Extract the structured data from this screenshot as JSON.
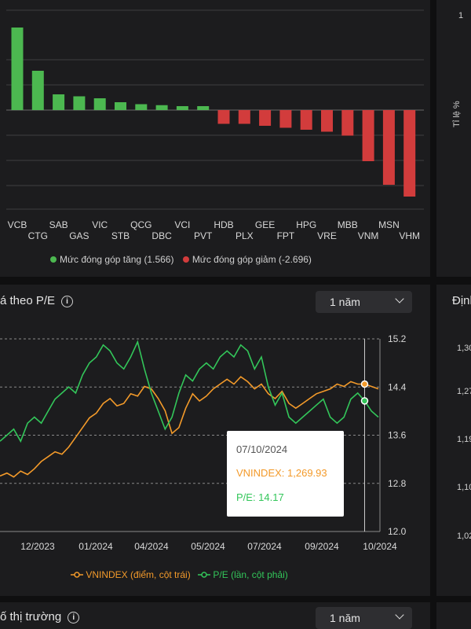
{
  "top_panel": {
    "legend_up": "Mức đóng góp tăng (1.566)",
    "legend_down": "Mức đóng góp giảm (-2.696)",
    "right_label": "Tỉ lệ %",
    "right_tick": "1",
    "colors": {
      "up": "#4cb850",
      "down": "#d23c3c"
    }
  },
  "middle_panel": {
    "title": "á theo P/E",
    "period": "1 năm",
    "legend_vnindex": "VNINDEX (điểm, cột trái)",
    "legend_pe": "P/E (lần, cột phải)",
    "colors": {
      "vnindex": "#f39a2a",
      "pe": "#33c65a"
    },
    "tooltip": {
      "date": "07/10/2024",
      "vnindex": "VNINDEX: 1,269.93",
      "pe": "P/E: 14.17"
    }
  },
  "bottom_panel": {
    "title": "ố thị trường",
    "period": "1 năm"
  },
  "right_partial": {
    "title": "Định",
    "ticks": [
      "1,30",
      "1,27",
      "1,19",
      "1,10",
      "1,02"
    ]
  },
  "chart_data": [
    {
      "type": "bar",
      "categories": [
        "VCB",
        "CTG",
        "SAB",
        "GAS",
        "VIC",
        "STB",
        "QCG",
        "DBC",
        "VCI",
        "PVT",
        "HDB",
        "PLX",
        "GEE",
        "FPT",
        "HPG",
        "VRE",
        "MBB",
        "VNM",
        "MSN",
        "VHM"
      ],
      "values": [
        0.42,
        0.2,
        0.08,
        0.07,
        0.06,
        0.04,
        0.03,
        0.025,
        0.02,
        0.02,
        -0.07,
        -0.07,
        -0.08,
        -0.09,
        -0.1,
        -0.11,
        -0.13,
        -0.26,
        -0.38,
        -0.44
      ],
      "series": [
        {
          "name": "Mức đóng góp tăng (1.566)"
        },
        {
          "name": "Mức đóng góp giảm (-2.696)"
        }
      ]
    },
    {
      "type": "line",
      "x_ticks": [
        "12/2023",
        "01/2024",
        "04/2024",
        "05/2024",
        "07/2024",
        "09/2024",
        "10/2024"
      ],
      "y2_ticks": [
        "15.2",
        "14.4",
        "13.6",
        "12.8",
        "12.0"
      ],
      "y2lim": [
        12.0,
        15.2
      ],
      "series": [
        {
          "name": "VNINDEX (điểm, cột trái)",
          "values": [
            1080,
            1086,
            1078,
            1090,
            1083,
            1095,
            1110,
            1120,
            1130,
            1125,
            1140,
            1160,
            1180,
            1200,
            1210,
            1230,
            1240,
            1225,
            1230,
            1250,
            1245,
            1265,
            1260,
            1240,
            1215,
            1168,
            1180,
            1220,
            1250,
            1235,
            1245,
            1260,
            1270,
            1280,
            1270,
            1285,
            1275,
            1260,
            1270,
            1250,
            1240,
            1255,
            1230,
            1220,
            1230,
            1240,
            1250,
            1255,
            1260,
            1270,
            1265,
            1275,
            1270,
            1269.93,
            1265,
            1260
          ]
        },
        {
          "name": "P/E (lần, cột phải)",
          "values": [
            13.5,
            13.6,
            13.7,
            13.5,
            13.8,
            13.9,
            13.8,
            14.0,
            14.2,
            14.3,
            14.4,
            14.3,
            14.6,
            14.8,
            14.9,
            15.1,
            15.0,
            14.8,
            14.7,
            14.9,
            15.15,
            14.7,
            14.3,
            14.0,
            13.7,
            13.9,
            14.3,
            14.6,
            14.5,
            14.7,
            14.8,
            14.7,
            14.9,
            15.0,
            14.9,
            15.1,
            15.0,
            14.7,
            14.9,
            14.4,
            14.1,
            14.3,
            13.9,
            13.8,
            13.9,
            14.0,
            14.1,
            14.2,
            13.9,
            13.8,
            13.9,
            14.2,
            14.3,
            14.17,
            14.0,
            13.9
          ]
        }
      ]
    }
  ]
}
